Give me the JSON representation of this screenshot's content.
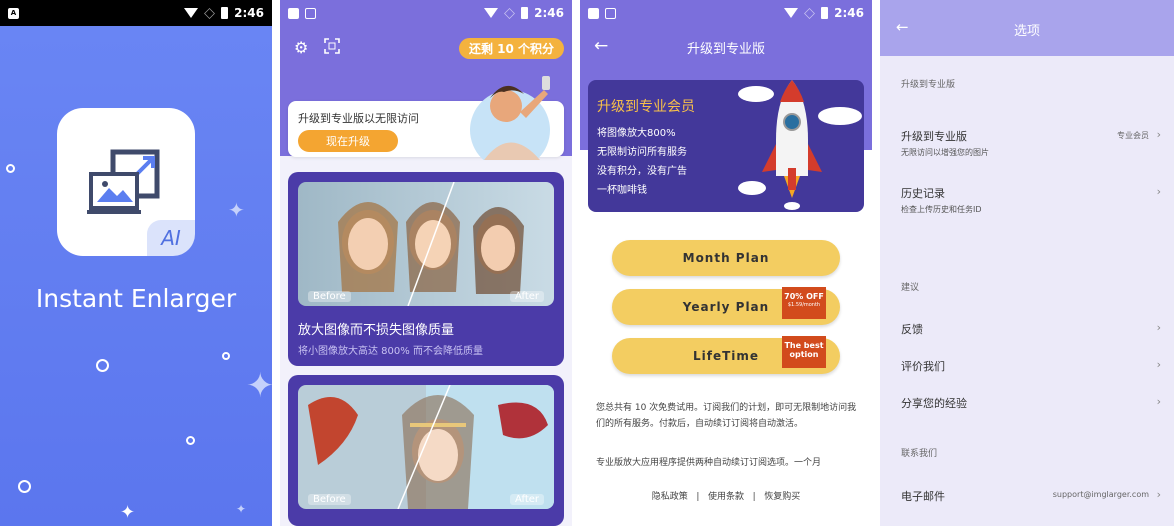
{
  "status": {
    "time": "2:46",
    "notif_icon": "A"
  },
  "splash": {
    "app_name": "Instant Enlarger",
    "badge": "AI",
    "bg_color": "#5f7af0"
  },
  "home": {
    "credits": "还剩 10 个积分",
    "promo_text": "升级到专业版以无限访问",
    "promo_button": "现在升级",
    "cards": [
      {
        "before": "Before",
        "after": "After",
        "title": "放大图像而不损失图像质量",
        "subtitle": "将小图像放大高达 800% 而不会降低质量"
      },
      {
        "before": "Before",
        "after": "After"
      }
    ]
  },
  "upgrade": {
    "title": "升级到专业版",
    "pro_title": "升级到专业会员",
    "features": [
      "将图像放大800%",
      "无限制访问所有服务",
      "没有积分，没有广告",
      "一杯咖啡钱"
    ],
    "plans": [
      {
        "label": "Month Plan"
      },
      {
        "label": "Yearly Plan",
        "ribbon": "70% OFF",
        "ribbon_sub": "$1.59/month"
      },
      {
        "label": "LifeTime",
        "ribbon": "The best option"
      }
    ],
    "desc1": "您总共有 10 次免费试用。订阅我们的计划，即可无限制地访问我们的所有服务。付款后，自动续订订阅将自动激活。",
    "desc2": "专业版放大应用程序提供两种自动续订订阅选项。一个月",
    "links": [
      "隐私政策",
      "使用条款",
      "恢复购买"
    ]
  },
  "options": {
    "title": "选项",
    "sec1": "升级到专业版",
    "upgrade_row": {
      "label": "升级到专业版",
      "sub": "无限访问以增强您的图片",
      "value": "专业会员"
    },
    "history_row": {
      "label": "历史记录",
      "sub": "检查上传历史和任务ID"
    },
    "sec2": "建议",
    "feedback": "反馈",
    "rate": "评价我们",
    "share": "分享您的经验",
    "sec3": "联系我们",
    "email_row": {
      "label": "电子邮件",
      "value": "support@imglarger.com"
    }
  }
}
